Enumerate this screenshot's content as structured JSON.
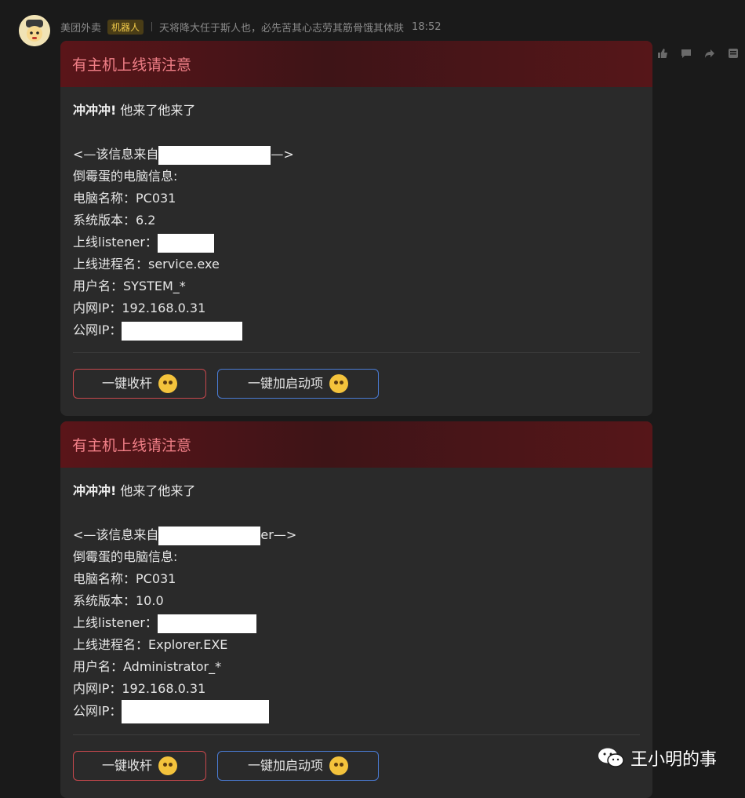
{
  "message": {
    "sender_name": "美团外卖",
    "sender_badge": "机器人",
    "sender_signature": "天将降大任于斯人也，必先苦其心志劳其筋骨饿其体肤",
    "time": "18:52"
  },
  "actions": [
    "thumbs-up-icon",
    "comment-icon",
    "forward-icon",
    "more-icon"
  ],
  "cards": [
    {
      "title": "有主机上线请注意",
      "lead_bold": "冲冲冲!",
      "lead_rest": " 他来了他来了",
      "source_prefix": "<—该信息来自",
      "source_suffix": "—>",
      "info_header": "倒霉蛋的电脑信息:",
      "computer_name": "电脑名称：PC031",
      "os_version": "系统版本：6.2",
      "listener_label": "上线listener：",
      "process": "上线进程名：service.exe",
      "username": "用户名：SYSTEM_*",
      "lan_ip": "内网IP：192.168.0.31",
      "wan_ip_label": "公网IP：",
      "btn_reel": "一键收杆",
      "btn_startup": "一键加启动项"
    },
    {
      "title": "有主机上线请注意",
      "lead_bold": "冲冲冲!",
      "lead_rest": " 他来了他来了",
      "source_prefix": "<—该信息来自",
      "source_suffix": "er—>",
      "info_header": "倒霉蛋的电脑信息:",
      "computer_name": "电脑名称：PC031",
      "os_version": "系统版本：10.0",
      "listener_label": "上线listener：",
      "process": "上线进程名：Explorer.EXE",
      "username": "用户名：Administrator_*",
      "lan_ip": "内网IP：192.168.0.31",
      "wan_ip_label": "公网IP：",
      "btn_reel": "一键收杆",
      "btn_startup": "一键加启动项"
    }
  ],
  "watermark": "王小明的事"
}
